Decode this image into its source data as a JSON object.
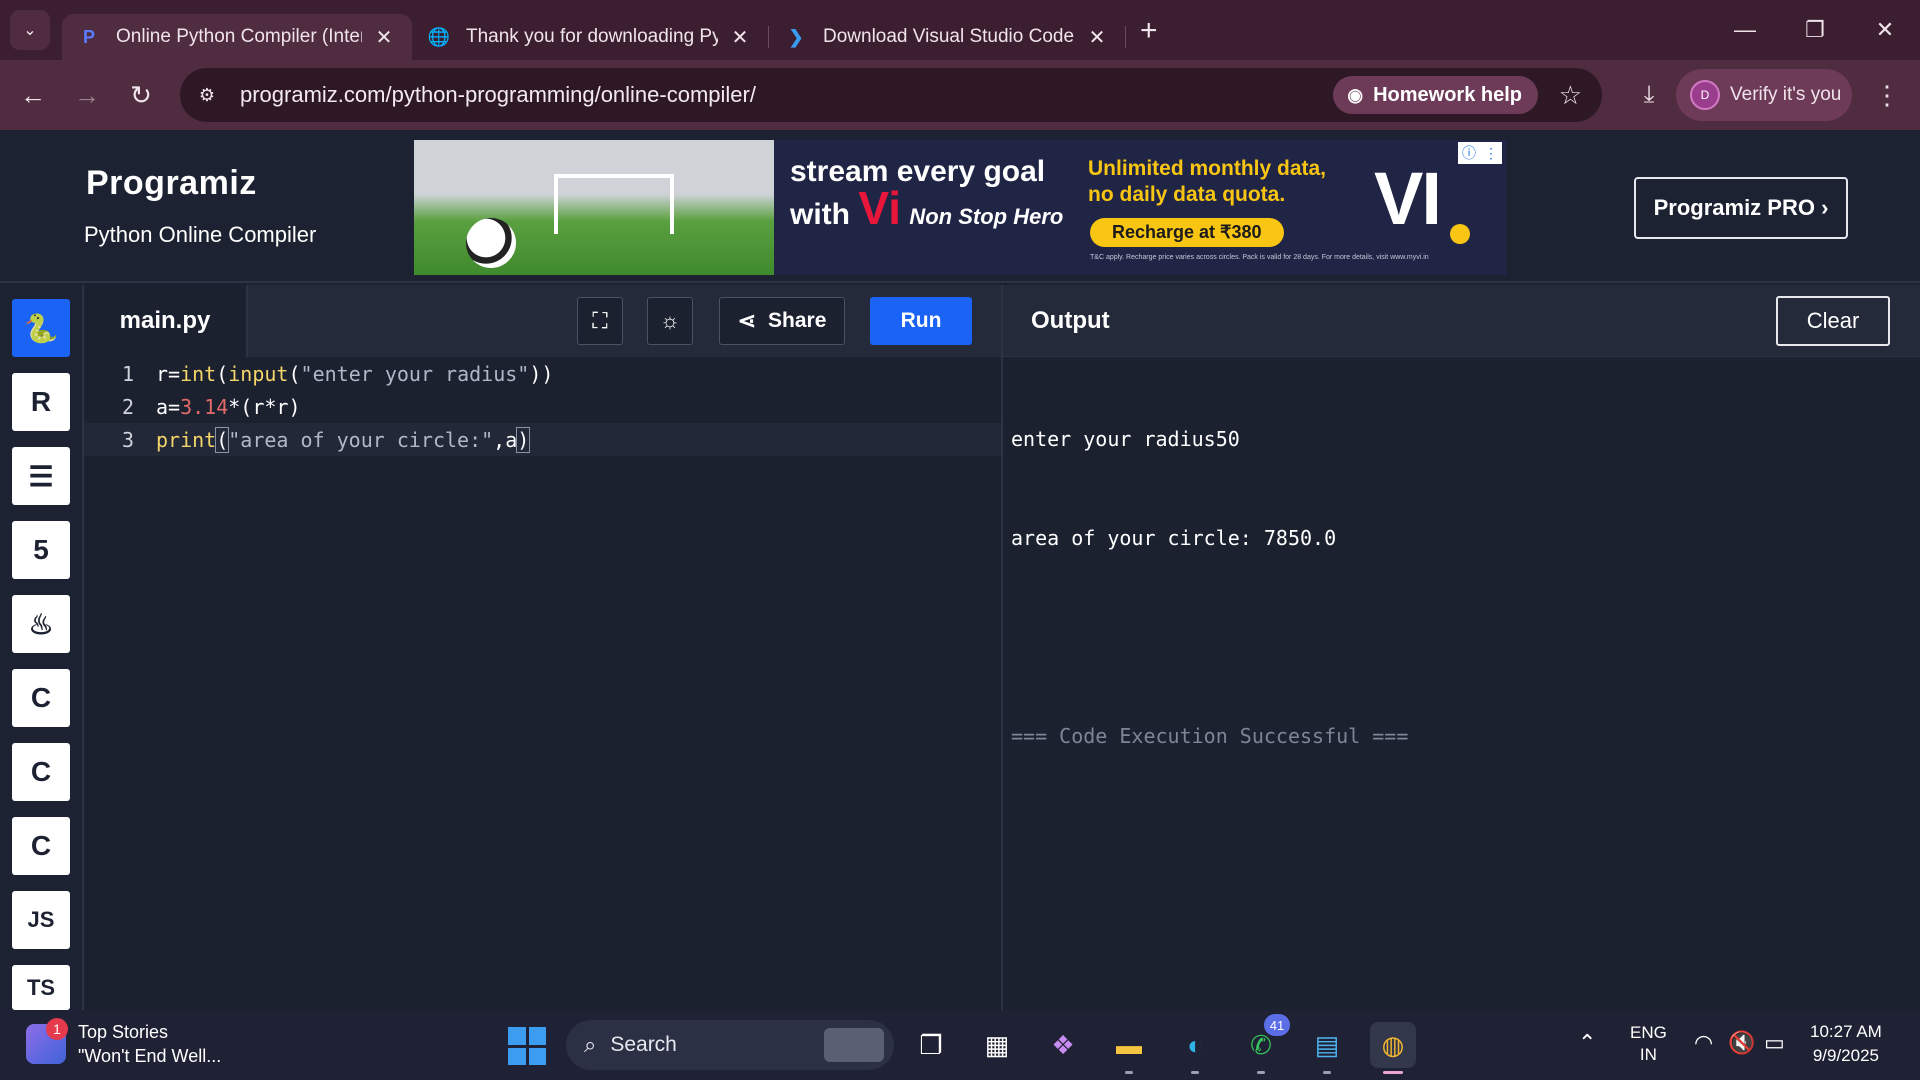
{
  "browser": {
    "tabs": [
      {
        "title": "Online Python Compiler (Interp",
        "active": true
      },
      {
        "title": "Thank you for downloading PyC",
        "active": false
      },
      {
        "title": "Download Visual Studio Code -",
        "active": false
      }
    ],
    "url": "programiz.com/python-programming/online-compiler/",
    "homework_help": "Homework help",
    "verify_label": "Verify it's you",
    "profile_initial": "D"
  },
  "header": {
    "logo": "Programiz",
    "subtitle": "Python Online Compiler",
    "pro_button": "Programiz PRO ›"
  },
  "ad": {
    "headline_1": "stream every goal",
    "headline_2": "with",
    "brand": "Vi",
    "tag": "Non Stop Hero",
    "offer_1": "Unlimited monthly data,",
    "offer_2": "no daily data quota.",
    "cta": "Recharge at ₹380",
    "fine_print": "T&C apply. Recharge price varies across circles. Pack is valid for 28 days. For more details, visit www.myvi.in",
    "logo_big": "VI"
  },
  "sidebar": {
    "languages": [
      {
        "name": "python",
        "label": "",
        "active": true
      },
      {
        "name": "r",
        "label": "R"
      },
      {
        "name": "sql",
        "label": ""
      },
      {
        "name": "html",
        "label": "5"
      },
      {
        "name": "java",
        "label": ""
      },
      {
        "name": "c",
        "label": "C"
      },
      {
        "name": "cpp",
        "label": "C"
      },
      {
        "name": "csharp",
        "label": "C"
      },
      {
        "name": "js",
        "label": "JS"
      },
      {
        "name": "ts",
        "label": "TS"
      }
    ]
  },
  "editor": {
    "filename": "main.py",
    "share_label": "Share",
    "run_label": "Run",
    "lines": [
      {
        "no": "1",
        "code": "r=int(input(\"enter your radius\"))"
      },
      {
        "no": "2",
        "code": "a=3.14*(r*r)"
      },
      {
        "no": "3",
        "code": "print(\"area of your circle:\",a)"
      }
    ]
  },
  "output": {
    "title": "Output",
    "clear_label": "Clear",
    "lines": [
      "enter your radius50",
      "area of your circle: 7850.0",
      "",
      "=== Code Execution Successful ==="
    ]
  },
  "taskbar": {
    "news_title": "Top Stories",
    "news_sub": "\"Won't End Well...",
    "news_badge": "1",
    "search_placeholder": "Search",
    "whatsapp_badge": "41",
    "lang_1": "ENG",
    "lang_2": "IN",
    "time": "10:27 AM",
    "date": "9/9/2025"
  }
}
